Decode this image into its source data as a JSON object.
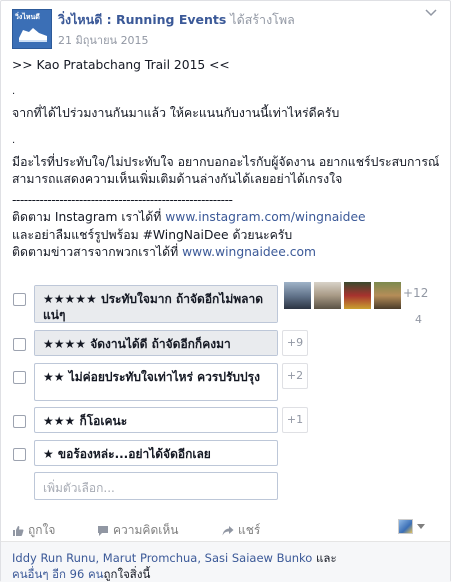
{
  "post": {
    "page_name": "วิ่งไหนดี : Running Events",
    "action": "ได้สร้างโพล",
    "date": "21 มิถุนายน 2015",
    "avatar_text": "วิ่งไหนดี"
  },
  "body": {
    "line1": ">> Kao Pratabchang Trail 2015 <<",
    "dot1": ".",
    "line2": "จากที่ได้ไปร่วมงานกันมาแล้ว ให้คะแนนกับงานนี้เท่าไหร่ดีครับ",
    "dot2": ".",
    "line3": "มีอะไรที่ประทับใจ/ไม่ประทับใจ อยากบอกอะไรกับผู้จัดงาน อยากแชร์ประสบการณ์ สามารถแสดงความเห็นเพิ่มเติมด้านล่างกันได้เลยอย่าได้เกรงใจ",
    "separator": "--------------------------------------------------------",
    "ig_prefix": "ติดตาม Instagram เราได้ที่ ",
    "ig_link": "www.instagram.com/wingnaidee",
    "share_line": "และอย่าลืมแชร์รูปพร้อม #WingNaiDee ด้วยนะครับ",
    "web_prefix": "ติดตามข่าวสารจากพวกเราได้ที่ ",
    "web_link": "www.wingnaidee.com"
  },
  "poll": {
    "options": [
      {
        "label": "★★★★★ ประทับใจมาก ถ้าจัดอีกไม่พลาดแน่ๆ",
        "more": "+12",
        "votes": "4"
      },
      {
        "label": "★★★★ จัดงานได้ดี ถ้าจัดอีกก็คงมา",
        "count": "+9"
      },
      {
        "label": "★★ ไม่ค่อยประทับใจเท่าไหร่ ควรปรับปรุง",
        "count": "+2"
      },
      {
        "label": "★★★ ก็โอเคนะ",
        "count": "+1"
      },
      {
        "label": "★ ขอร้องหล่ะ...อย่าได้จัดอีกเลย"
      }
    ],
    "add_placeholder": "เพิ่มตัวเลือก..."
  },
  "actions": {
    "like": "ถูกใจ",
    "comment": "ความคิดเห็น",
    "share": "แชร์"
  },
  "footer": {
    "names": "Iddy Run Runu, Marut Promchua, Sasi Saiaew Bunko",
    "and": " และ",
    "others_link": "คนอื่นๆ อีก 96 คน",
    "suffix": "ถูกใจสิ่งนี้"
  },
  "colors": {
    "link": "#3b5998",
    "muted": "#9197a3",
    "accent_avatar": "#3b6fb6"
  }
}
